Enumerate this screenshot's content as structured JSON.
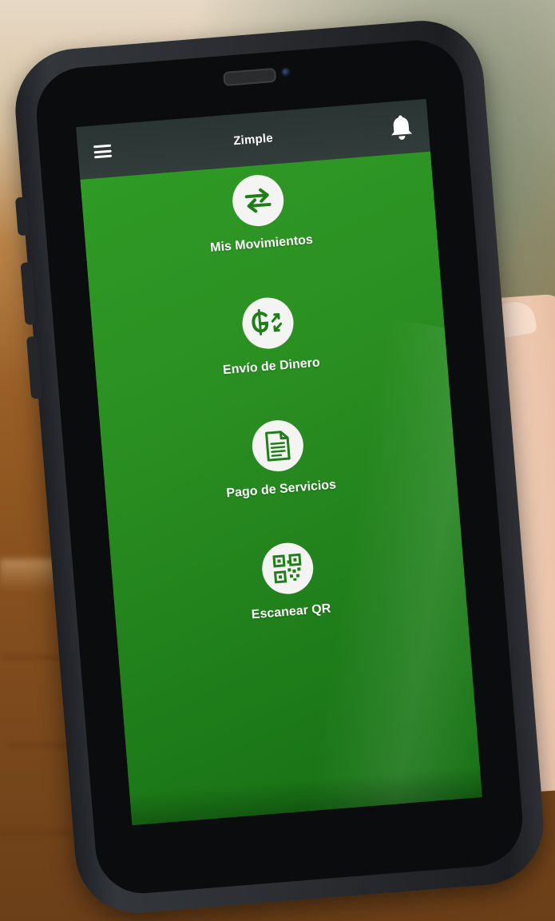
{
  "app": {
    "title": "Zimple"
  },
  "header": {
    "menu_icon": "hamburger-menu-icon",
    "notification_icon": "bell-icon"
  },
  "actions": [
    {
      "label": "Mis Movimientos",
      "icon": "transfer-arrows-icon"
    },
    {
      "label": "Envío de Dinero",
      "icon": "money-send-icon"
    },
    {
      "label": "Pago de Servicios",
      "icon": "document-icon"
    },
    {
      "label": "Escanear QR",
      "icon": "qr-code-icon"
    }
  ],
  "colors": {
    "primary_green": "#2a8f22",
    "app_bar": "#2e3937",
    "icon_background": "#f4f5f3",
    "icon_foreground": "#1f7e1a"
  }
}
